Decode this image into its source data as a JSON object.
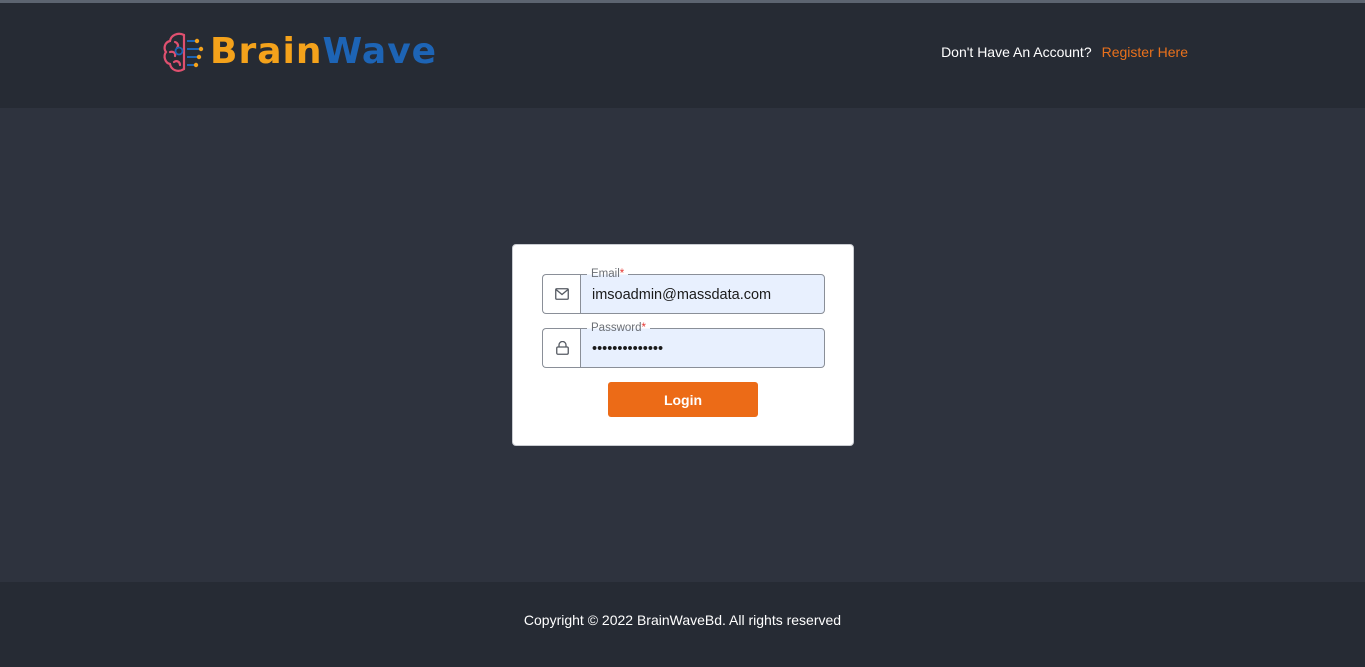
{
  "brand": {
    "part1": "Brain",
    "part2": "Wave",
    "logo_icon": "brain-circuit-icon",
    "colors": {
      "part1": "#f4a21b",
      "part2": "#1d64b5",
      "brain": "#e0506f"
    }
  },
  "header": {
    "question": "Don't Have An Account?",
    "register_link": "Register Here",
    "accent": "#e9711c"
  },
  "login_form": {
    "email": {
      "label": "Email",
      "required_mark": "*",
      "value": "imsoadmin@massdata.com",
      "icon": "mail-icon"
    },
    "password": {
      "label": "Password",
      "required_mark": "*",
      "value": "••••••••••••••",
      "icon": "lock-icon"
    },
    "submit_label": "Login",
    "submit_color": "#ec6b17"
  },
  "footer": {
    "copyright": "Copyright © 2022 BrainWaveBd. All rights reserved"
  }
}
